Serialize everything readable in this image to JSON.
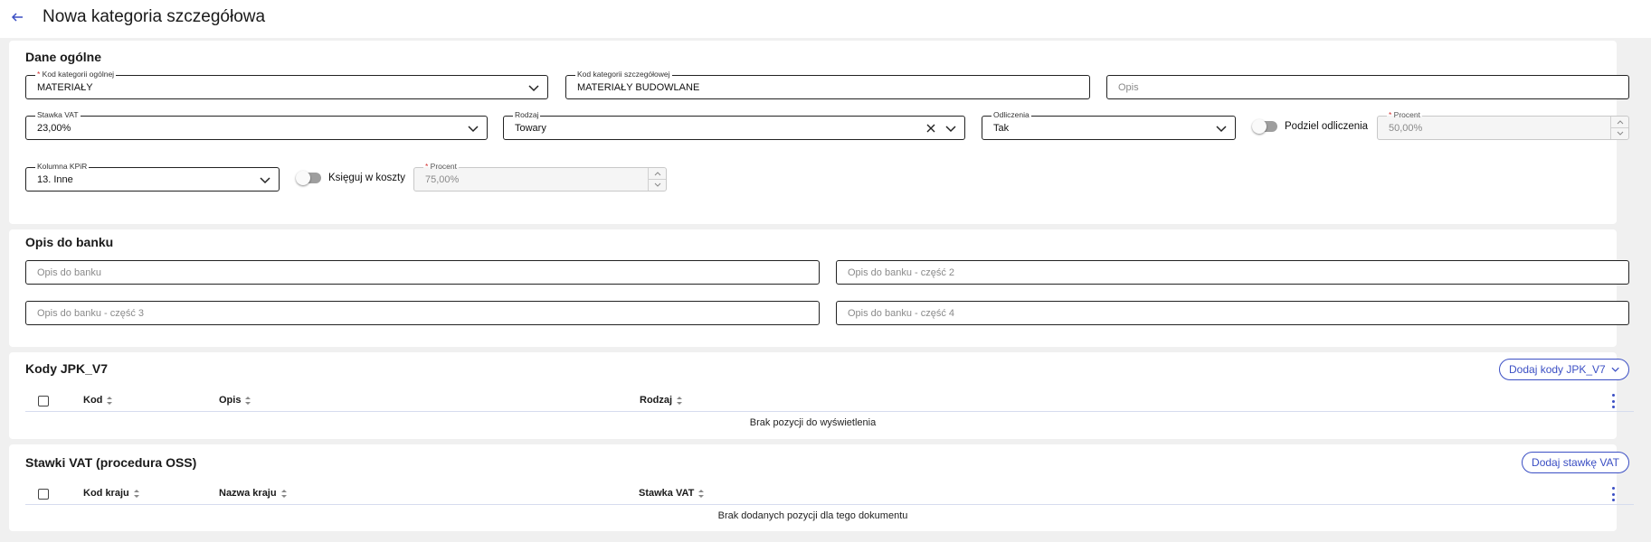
{
  "header": {
    "title": "Nowa kategoria szczegółowa"
  },
  "general": {
    "title": "Dane ogólne",
    "kod_kategorii_ogolnej": {
      "label": "Kod kategorii ogólnej",
      "value": "MATERIAŁY"
    },
    "kod_kategorii_szczegolowej": {
      "label": "Kod kategorii szczegółowej",
      "value": "MATERIAŁY BUDOWLANE"
    },
    "opis": {
      "placeholder": "Opis"
    },
    "stawka_vat": {
      "label": "Stawka VAT",
      "value": "23,00%"
    },
    "rodzaj": {
      "label": "Rodzaj",
      "value": "Towary"
    },
    "odliczenia": {
      "label": "Odliczenia",
      "value": "Tak"
    },
    "podziel_odliczenia": {
      "label": "Podziel odliczenia"
    },
    "procent1": {
      "label": "Procent",
      "value": "50,00%"
    },
    "kolumna_kpir": {
      "label": "Kolumna KPiR",
      "value": "13. Inne"
    },
    "ksieguj": {
      "label": "Księguj w koszty"
    },
    "procent2": {
      "label": "Procent",
      "value": "75,00%"
    }
  },
  "bank": {
    "title": "Opis do banku",
    "p1": "Opis do banku",
    "p2": "Opis do banku - część 2",
    "p3": "Opis do banku - część 3",
    "p4": "Opis do banku - część 4"
  },
  "jpk": {
    "title": "Kody JPK_V7",
    "add_label": "Dodaj kody JPK_V7",
    "columns": [
      "Kod",
      "Opis",
      "Rodzaj"
    ],
    "empty": "Brak pozycji do wyświetlenia"
  },
  "oss": {
    "title": "Stawki VAT (procedura OSS)",
    "add_label": "Dodaj stawkę VAT",
    "columns": [
      "Kod kraju",
      "Nazwa kraju",
      "Stawka VAT"
    ],
    "empty": "Brak dodanych pozycji dla tego dokumentu"
  }
}
